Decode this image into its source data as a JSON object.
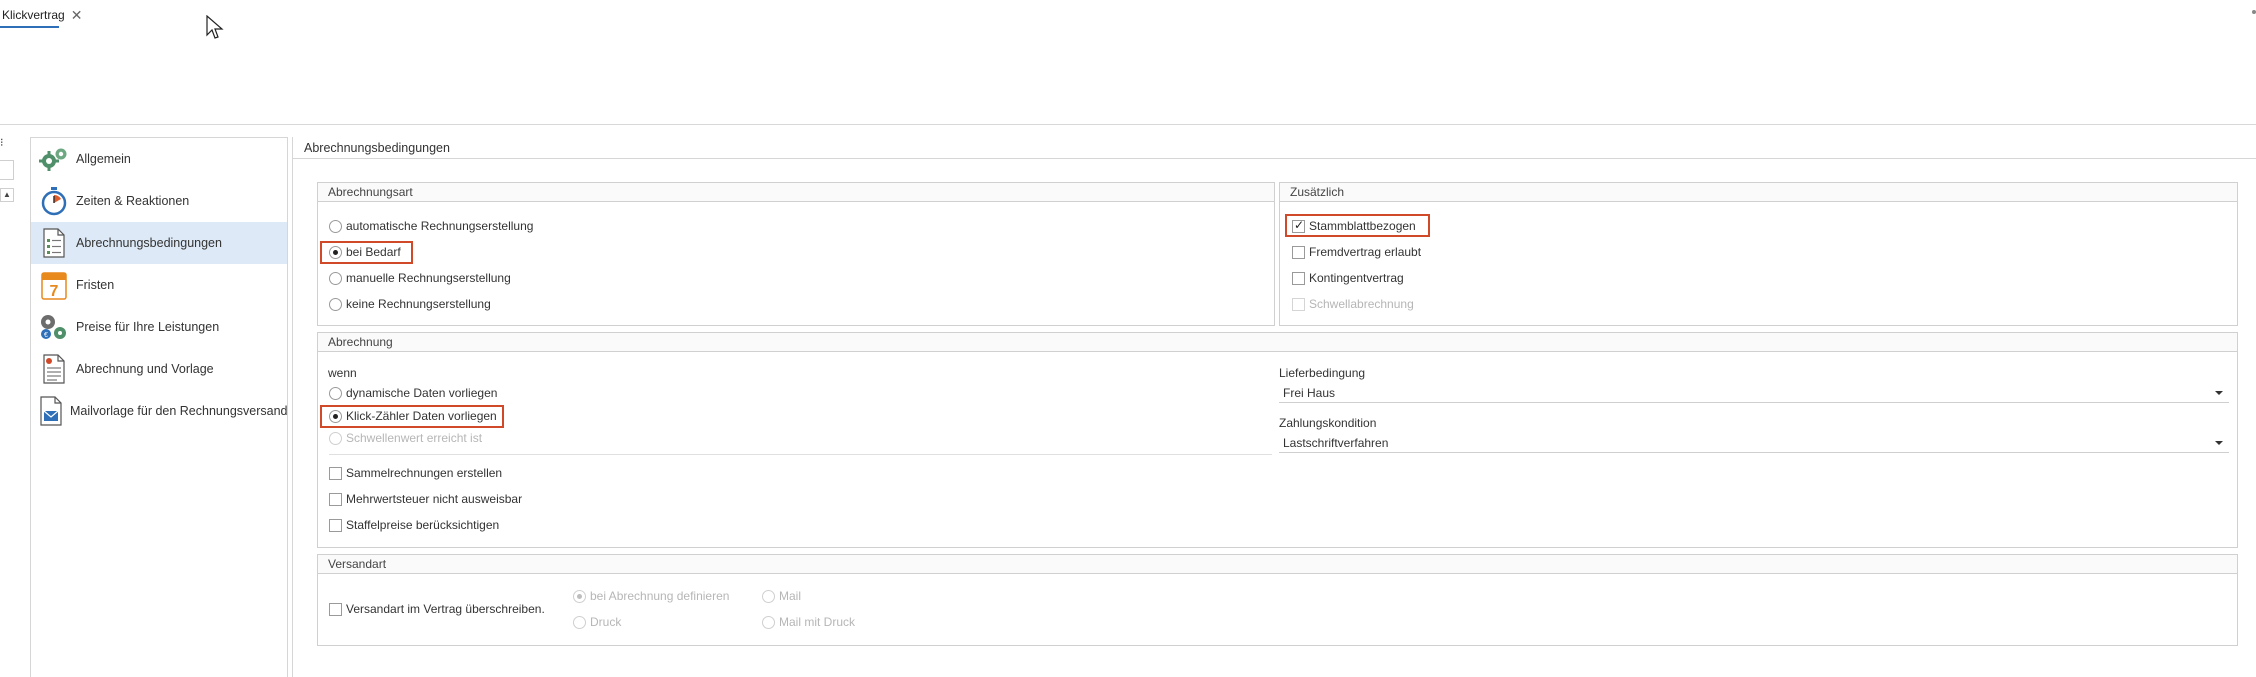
{
  "tab": {
    "label": "Klickvertrag"
  },
  "nav": {
    "items": [
      {
        "label": "Allgemein",
        "icon": "gears-icon"
      },
      {
        "label": "Zeiten & Reaktionen",
        "icon": "stopwatch-icon"
      },
      {
        "label": "Abrechnungsbedingungen",
        "icon": "document-list-icon",
        "active": true
      },
      {
        "label": "Fristen",
        "icon": "calendar-icon",
        "day": "7"
      },
      {
        "label": "Preise für Ihre Leistungen",
        "icon": "price-gears-icon"
      },
      {
        "label": "Abrechnung und Vorlage",
        "icon": "document-icon"
      },
      {
        "label": "Mailvorlage für den Rechnungsversand",
        "icon": "mail-document-icon"
      }
    ]
  },
  "main": {
    "title": "Abrechnungsbedingungen",
    "abrechnungsart": {
      "title": "Abrechnungsart",
      "options": [
        "automatische Rechnungserstellung",
        "bei Bedarf",
        "manuelle Rechnungserstellung",
        "keine Rechnungserstellung"
      ],
      "selected": "bei Bedarf"
    },
    "zusaetzlich": {
      "title": "Zusätzlich",
      "options": [
        {
          "label": "Stammblattbezogen",
          "checked": true,
          "disabled": false
        },
        {
          "label": "Fremdvertrag erlaubt",
          "checked": false,
          "disabled": false
        },
        {
          "label": "Kontingentvertrag",
          "checked": false,
          "disabled": false
        },
        {
          "label": "Schwellabrechnung",
          "checked": false,
          "disabled": true
        }
      ]
    },
    "abrechnung": {
      "title": "Abrechnung",
      "wenn_label": "wenn",
      "options": [
        "dynamische Daten vorliegen",
        "Klick-Zähler Daten vorliegen",
        "Schwellenwert erreicht ist"
      ],
      "selected": "Klick-Zähler Daten vorliegen",
      "checkboxes": [
        "Sammelrechnungen erstellen",
        "Mehrwertsteuer nicht ausweisbar",
        "Staffelpreise berücksichtigen"
      ],
      "lieferbedingung_label": "Lieferbedingung",
      "lieferbedingung_value": "Frei Haus",
      "zahlungskondition_label": "Zahlungskondition",
      "zahlungskondition_value": "Lastschriftverfahren"
    },
    "versandart": {
      "title": "Versandart",
      "override_label": "Versandart im Vertrag überschreiben.",
      "options": [
        "bei Abrechnung definieren",
        "Mail",
        "Druck",
        "Mail mit Druck"
      ],
      "selected": "bei Abrechnung definieren"
    }
  },
  "colors": {
    "accent": "#2e6fb7",
    "highlight": "#d04a2a",
    "active_bg": "#dde9f6"
  }
}
